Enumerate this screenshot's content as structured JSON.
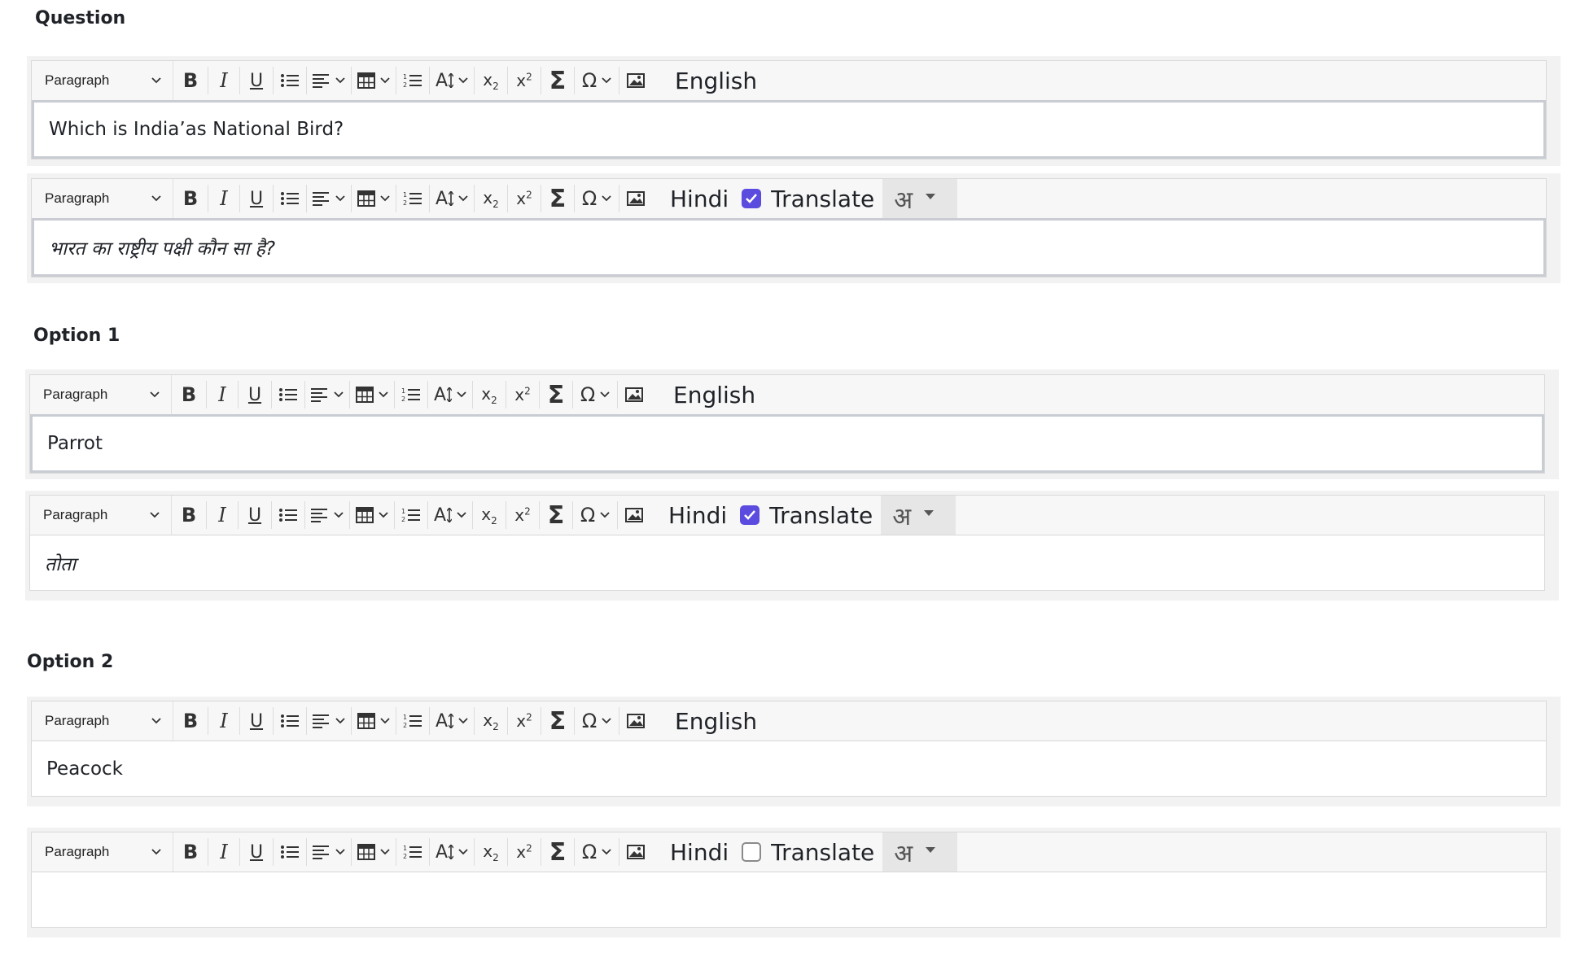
{
  "sections": {
    "question": "Question",
    "option1": "Option 1",
    "option2": "Option 2"
  },
  "toolbar": {
    "paragraph": "Paragraph",
    "translate": "Translate",
    "ime_glyph": "अ"
  },
  "editors": [
    {
      "language": "English",
      "content": "Which is India’as National Bird?"
    },
    {
      "language": "Hindi",
      "translate_checked": true,
      "content": "भारत का राष्ट्रीय पक्षी कौन सा है?"
    },
    {
      "language": "English",
      "content": "Parrot"
    },
    {
      "language": "Hindi",
      "translate_checked": true,
      "content": "तोता"
    },
    {
      "language": "English",
      "content": "Peacock"
    },
    {
      "language": "Hindi",
      "translate_checked": false,
      "content": ""
    }
  ],
  "colors": {
    "checkbox_on": "#5b4bdf",
    "panel_bg": "#f2f2f2"
  }
}
